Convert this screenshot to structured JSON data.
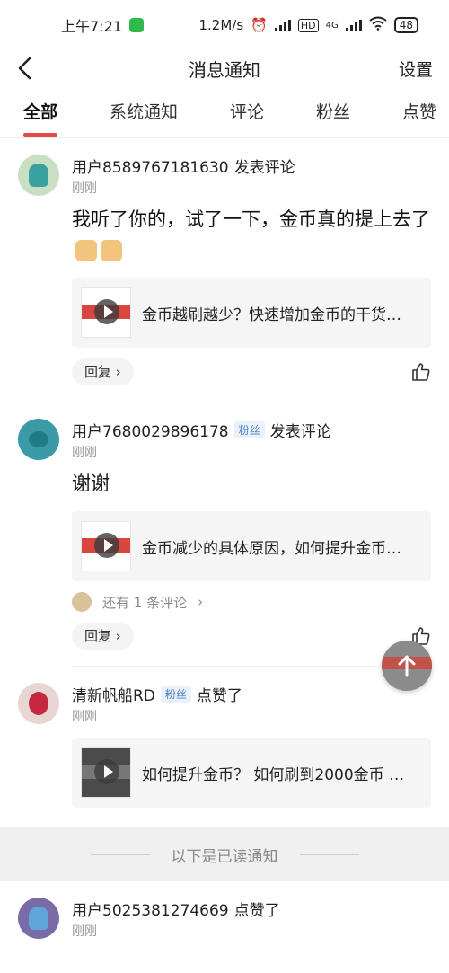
{
  "status_bar": {
    "time": "上午7:21",
    "speed": "1.2M/s",
    "hd": "HD",
    "network": "4G",
    "battery": "48"
  },
  "nav": {
    "title": "消息通知",
    "settings": "设置"
  },
  "tabs": [
    {
      "label": "全部",
      "active": true
    },
    {
      "label": "系统通知"
    },
    {
      "label": "评论"
    },
    {
      "label": "粉丝"
    },
    {
      "label": "点赞"
    }
  ],
  "notifications": [
    {
      "user": "用户8589767181630",
      "action": "发表评论",
      "time": "刚刚",
      "content": "我听了你的，试了一下，金币真的提上去了",
      "ref_title": "金币越刷越少？快速增加金币的干货…",
      "reply_label": "回复"
    },
    {
      "user": "用户7680029896178",
      "badge": "粉丝",
      "action": "发表评论",
      "time": "刚刚",
      "content": "谢谢",
      "ref_title": "金币减少的具体原因，如何提升金币…",
      "more_replies": "还有 1 条评论",
      "reply_label": "回复"
    },
    {
      "user": "清新帆船RD",
      "badge": "粉丝",
      "action": "点赞了",
      "time": "刚刚",
      "ref_title": "如何提升金币？ 如何刷到2000金币 …"
    },
    {
      "user": "用户5025381274669",
      "action": "点赞了",
      "time": "刚刚"
    }
  ],
  "read_divider": "以下是已读通知"
}
